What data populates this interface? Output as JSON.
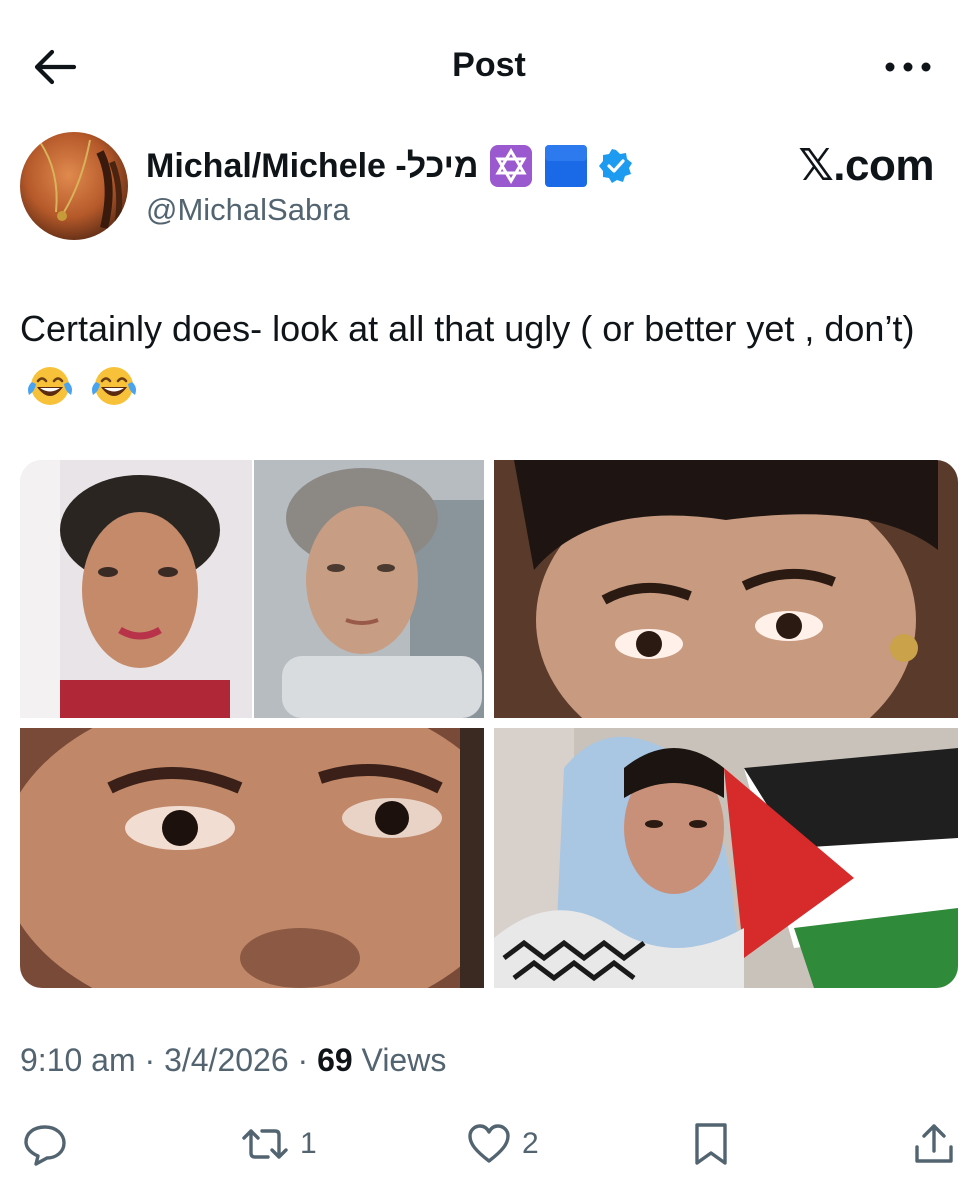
{
  "header": {
    "title": "Post",
    "back_icon": "arrow-left-icon",
    "more_icon": "more-horizontal-icon"
  },
  "author": {
    "display_name": "Michal/Michele -מיכל",
    "handle": "@MichalSabra",
    "name_badges": [
      "star-of-david-emoji",
      "blue-square-emoji",
      "verified-badge-icon"
    ],
    "verified_color": "#1d9bf0"
  },
  "source_label": "𝕏.com",
  "post": {
    "text": "Certainly does- look at all that ugly ( or better yet , don’t)",
    "trailing_emojis": [
      "face-with-tears-of-joy-emoji",
      "face-with-tears-of-joy-emoji"
    ],
    "media_count": 4
  },
  "meta": {
    "time": "9:10 am",
    "separator": "·",
    "date": "3/4/2026",
    "views_count": "69",
    "views_label": "Views"
  },
  "actions": {
    "reply": {
      "icon": "reply-icon",
      "count": ""
    },
    "repost": {
      "icon": "repost-icon",
      "count": "1"
    },
    "like": {
      "icon": "heart-icon",
      "count": "2"
    },
    "bookmark": {
      "icon": "bookmark-icon",
      "count": ""
    },
    "share": {
      "icon": "share-icon",
      "count": ""
    }
  },
  "colors": {
    "text_primary": "#0f1419",
    "text_secondary": "#536471",
    "accent": "#1d9bf0"
  }
}
